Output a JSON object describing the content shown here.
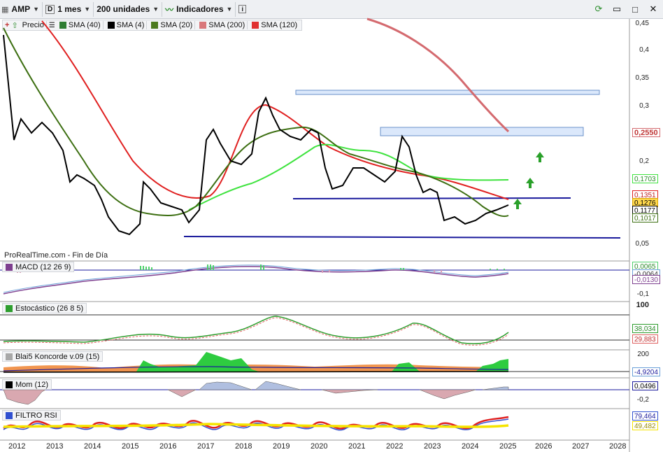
{
  "toolbar": {
    "ticker": "AMP",
    "period": "1 mes",
    "units": "200 unidades",
    "indicators": "Indicadores"
  },
  "legend": {
    "price": "Precio",
    "items": [
      {
        "label": "SMA (40)",
        "color": "#2e7d32"
      },
      {
        "label": "SMA (4)",
        "color": "#000000"
      },
      {
        "label": "SMA (20)",
        "color": "#4b7a1e"
      },
      {
        "label": "SMA (200)",
        "color": "#d9777a"
      },
      {
        "label": "SMA (120)",
        "color": "#e03030"
      }
    ]
  },
  "watermark": "ProRealTime.com - Fin de Día",
  "price_axis": [
    "0,45",
    "0,4",
    "0,35",
    "0,3",
    "0,2",
    "0,05"
  ],
  "price_tags": {
    "sma200": "0,2550",
    "sma40": "0,1703",
    "sma120": "0,1351",
    "price": "0,1276",
    "sma4": "0,1177",
    "sma20": "0,1017"
  },
  "panels": {
    "macd": {
      "label": "MACD (12 26 9)",
      "tag1": "0,0065",
      "tag2": "-0,0064",
      "tag3": "-0,0130",
      "axis": "-0,1"
    },
    "stoch": {
      "label": "Estocástico (26 8 5)",
      "tag1": "38,034",
      "tag2": "29,883",
      "axis": "100"
    },
    "koncorde": {
      "label": "Blai5 Koncorde v.09 (15)",
      "tag1": "-4,9204",
      "axis": "200"
    },
    "mom": {
      "label": "Mom (12)",
      "tag1": "0,0496",
      "axis": "-0,2"
    },
    "rsi": {
      "label": "FILTRO RSI",
      "tag1": "79,464",
      "tag2": "49,482"
    }
  },
  "years": [
    "2012",
    "2013",
    "2014",
    "2015",
    "2016",
    "2017",
    "2018",
    "2019",
    "2020",
    "2021",
    "2022",
    "2023",
    "2024",
    "2025",
    "2026",
    "2027",
    "2028"
  ],
  "colors": {
    "sma40": "#3fe33f",
    "sma120": "#e02020",
    "sma200": "#d46a6f",
    "sma20": "#3d6f12",
    "support": "#1a1a9c"
  }
}
